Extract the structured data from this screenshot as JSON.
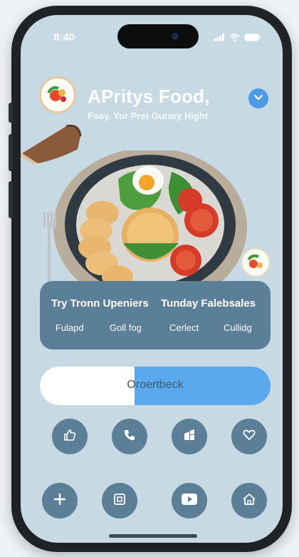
{
  "status_bar": {
    "time": "8:40"
  },
  "header": {
    "title": "APritys Food,",
    "subtitle": "Foay. Yor Pret Gurary Hight"
  },
  "card": {
    "left_heading": "Try Tronn Upeniers",
    "right_heading": "Tunday Falebsales",
    "labels": [
      "Fulapd",
      "Goll fog",
      "Cerlect",
      "Cullidg"
    ]
  },
  "progress_pill": {
    "label": "Oroertbeck",
    "progress": 0.41
  },
  "icon_row_1": [
    "thumbs-up-icon",
    "phone-icon",
    "grid-icon",
    "heart-icon"
  ],
  "icon_row_2": [
    "plus-icon",
    "square-icon",
    "play-icon",
    "home-icon"
  ],
  "colors": {
    "screen_bg": "#c7d9e3",
    "card_bg": "#5c7f98",
    "accent_blue": "#4a9ae8",
    "pill_blue": "#5aa9ef"
  }
}
